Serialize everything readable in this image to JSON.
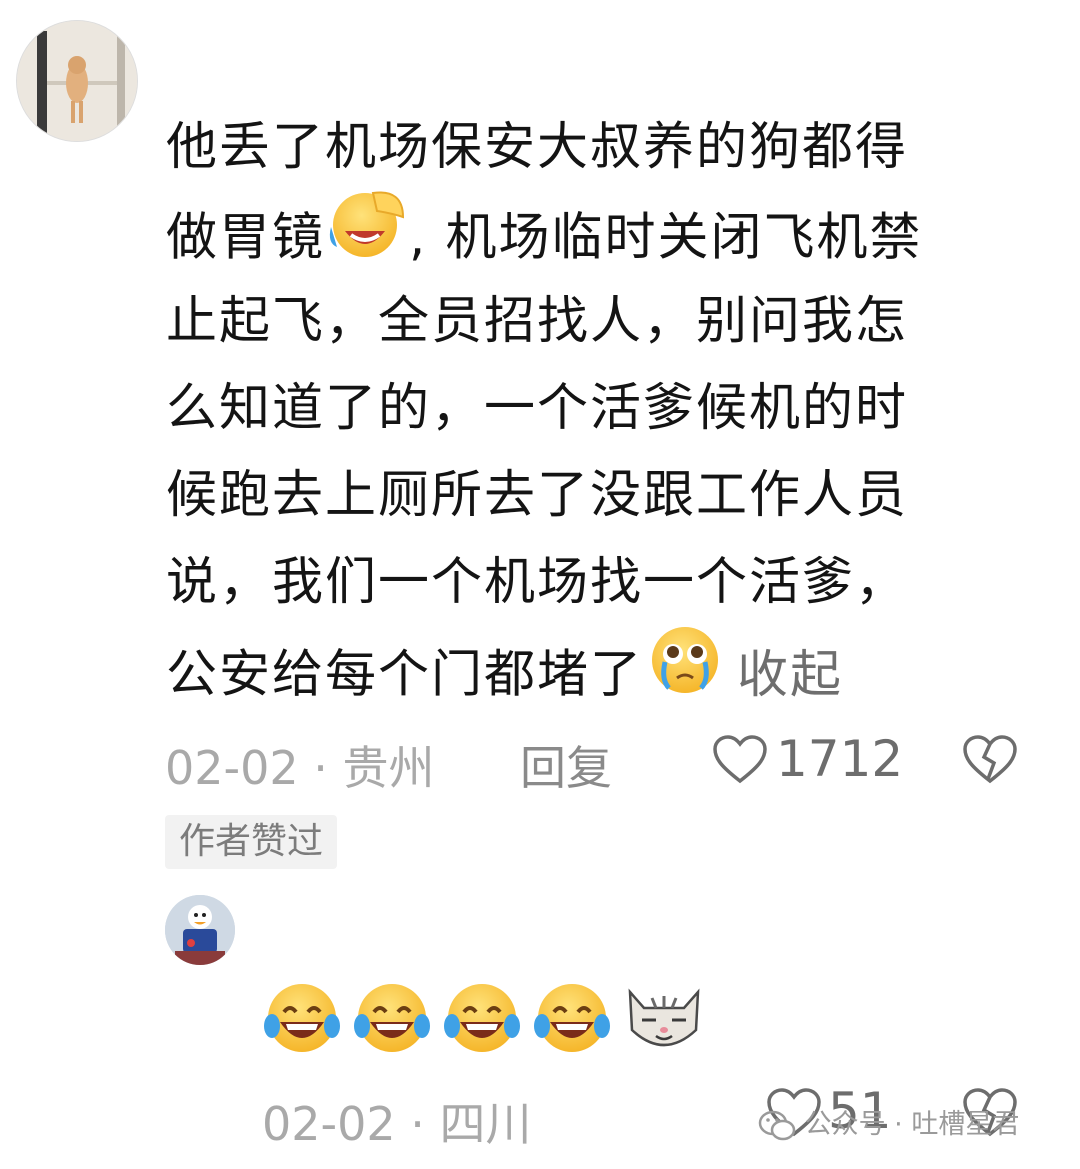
{
  "comment1": {
    "avatar_icon": "avatar-dog-photo",
    "lines": [
      "他丢了机场保安大叔养的狗都得",
      "做胃镜",
      ", 机场临时关闭飞机禁",
      "止起飞，全员招找人，别问我怎",
      "么知道了的，一个活爹候机的时",
      "候跑去上厕所去了没跟工作人员",
      "说，我们一个机场找一个活爹，",
      "公安给每个门都堵了"
    ],
    "emoji_1": "facepalm-laugh-emoji",
    "emoji_2": "crying-pleading-emoji",
    "collapse_label": "收起",
    "date": "02-02",
    "separator": "·",
    "location": "贵州",
    "reply_label": "回复",
    "like_count": "1712",
    "badge": "作者赞过"
  },
  "comment2": {
    "avatar_icon": "avatar-cartoon-character",
    "emojis": [
      "tears-of-joy-emoji",
      "tears-of-joy-emoji",
      "tears-of-joy-emoji",
      "tears-of-joy-emoji",
      "smug-cat-emoji"
    ],
    "date": "02-02",
    "separator": "·",
    "location": "四川",
    "like_count": "51"
  },
  "watermark": {
    "icon": "wechat-icon",
    "text": "公众号 · 吐槽星君"
  },
  "colors": {
    "text": "#141414",
    "meta": "#a9a9a9",
    "badge_bg": "#f2f2f2",
    "emoji_yellow": "#f8c33a",
    "tear_blue": "#3fa1e6"
  }
}
